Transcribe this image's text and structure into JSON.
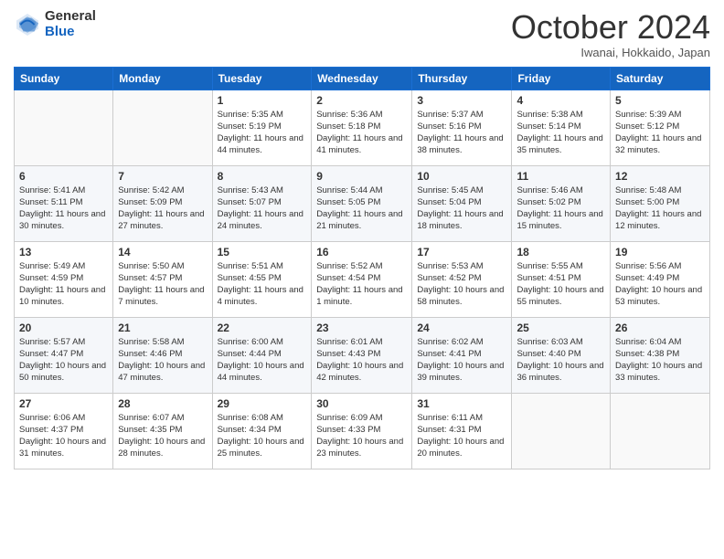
{
  "header": {
    "logo": {
      "general": "General",
      "blue": "Blue"
    },
    "title": "October 2024",
    "location": "Iwanai, Hokkaido, Japan"
  },
  "weekdays": [
    "Sunday",
    "Monday",
    "Tuesday",
    "Wednesday",
    "Thursday",
    "Friday",
    "Saturday"
  ],
  "weeks": [
    [
      {
        "day": "",
        "sunrise": "",
        "sunset": "",
        "daylight": ""
      },
      {
        "day": "",
        "sunrise": "",
        "sunset": "",
        "daylight": ""
      },
      {
        "day": "1",
        "sunrise": "Sunrise: 5:35 AM",
        "sunset": "Sunset: 5:19 PM",
        "daylight": "Daylight: 11 hours and 44 minutes."
      },
      {
        "day": "2",
        "sunrise": "Sunrise: 5:36 AM",
        "sunset": "Sunset: 5:18 PM",
        "daylight": "Daylight: 11 hours and 41 minutes."
      },
      {
        "day": "3",
        "sunrise": "Sunrise: 5:37 AM",
        "sunset": "Sunset: 5:16 PM",
        "daylight": "Daylight: 11 hours and 38 minutes."
      },
      {
        "day": "4",
        "sunrise": "Sunrise: 5:38 AM",
        "sunset": "Sunset: 5:14 PM",
        "daylight": "Daylight: 11 hours and 35 minutes."
      },
      {
        "day": "5",
        "sunrise": "Sunrise: 5:39 AM",
        "sunset": "Sunset: 5:12 PM",
        "daylight": "Daylight: 11 hours and 32 minutes."
      }
    ],
    [
      {
        "day": "6",
        "sunrise": "Sunrise: 5:41 AM",
        "sunset": "Sunset: 5:11 PM",
        "daylight": "Daylight: 11 hours and 30 minutes."
      },
      {
        "day": "7",
        "sunrise": "Sunrise: 5:42 AM",
        "sunset": "Sunset: 5:09 PM",
        "daylight": "Daylight: 11 hours and 27 minutes."
      },
      {
        "day": "8",
        "sunrise": "Sunrise: 5:43 AM",
        "sunset": "Sunset: 5:07 PM",
        "daylight": "Daylight: 11 hours and 24 minutes."
      },
      {
        "day": "9",
        "sunrise": "Sunrise: 5:44 AM",
        "sunset": "Sunset: 5:05 PM",
        "daylight": "Daylight: 11 hours and 21 minutes."
      },
      {
        "day": "10",
        "sunrise": "Sunrise: 5:45 AM",
        "sunset": "Sunset: 5:04 PM",
        "daylight": "Daylight: 11 hours and 18 minutes."
      },
      {
        "day": "11",
        "sunrise": "Sunrise: 5:46 AM",
        "sunset": "Sunset: 5:02 PM",
        "daylight": "Daylight: 11 hours and 15 minutes."
      },
      {
        "day": "12",
        "sunrise": "Sunrise: 5:48 AM",
        "sunset": "Sunset: 5:00 PM",
        "daylight": "Daylight: 11 hours and 12 minutes."
      }
    ],
    [
      {
        "day": "13",
        "sunrise": "Sunrise: 5:49 AM",
        "sunset": "Sunset: 4:59 PM",
        "daylight": "Daylight: 11 hours and 10 minutes."
      },
      {
        "day": "14",
        "sunrise": "Sunrise: 5:50 AM",
        "sunset": "Sunset: 4:57 PM",
        "daylight": "Daylight: 11 hours and 7 minutes."
      },
      {
        "day": "15",
        "sunrise": "Sunrise: 5:51 AM",
        "sunset": "Sunset: 4:55 PM",
        "daylight": "Daylight: 11 hours and 4 minutes."
      },
      {
        "day": "16",
        "sunrise": "Sunrise: 5:52 AM",
        "sunset": "Sunset: 4:54 PM",
        "daylight": "Daylight: 11 hours and 1 minute."
      },
      {
        "day": "17",
        "sunrise": "Sunrise: 5:53 AM",
        "sunset": "Sunset: 4:52 PM",
        "daylight": "Daylight: 10 hours and 58 minutes."
      },
      {
        "day": "18",
        "sunrise": "Sunrise: 5:55 AM",
        "sunset": "Sunset: 4:51 PM",
        "daylight": "Daylight: 10 hours and 55 minutes."
      },
      {
        "day": "19",
        "sunrise": "Sunrise: 5:56 AM",
        "sunset": "Sunset: 4:49 PM",
        "daylight": "Daylight: 10 hours and 53 minutes."
      }
    ],
    [
      {
        "day": "20",
        "sunrise": "Sunrise: 5:57 AM",
        "sunset": "Sunset: 4:47 PM",
        "daylight": "Daylight: 10 hours and 50 minutes."
      },
      {
        "day": "21",
        "sunrise": "Sunrise: 5:58 AM",
        "sunset": "Sunset: 4:46 PM",
        "daylight": "Daylight: 10 hours and 47 minutes."
      },
      {
        "day": "22",
        "sunrise": "Sunrise: 6:00 AM",
        "sunset": "Sunset: 4:44 PM",
        "daylight": "Daylight: 10 hours and 44 minutes."
      },
      {
        "day": "23",
        "sunrise": "Sunrise: 6:01 AM",
        "sunset": "Sunset: 4:43 PM",
        "daylight": "Daylight: 10 hours and 42 minutes."
      },
      {
        "day": "24",
        "sunrise": "Sunrise: 6:02 AM",
        "sunset": "Sunset: 4:41 PM",
        "daylight": "Daylight: 10 hours and 39 minutes."
      },
      {
        "day": "25",
        "sunrise": "Sunrise: 6:03 AM",
        "sunset": "Sunset: 4:40 PM",
        "daylight": "Daylight: 10 hours and 36 minutes."
      },
      {
        "day": "26",
        "sunrise": "Sunrise: 6:04 AM",
        "sunset": "Sunset: 4:38 PM",
        "daylight": "Daylight: 10 hours and 33 minutes."
      }
    ],
    [
      {
        "day": "27",
        "sunrise": "Sunrise: 6:06 AM",
        "sunset": "Sunset: 4:37 PM",
        "daylight": "Daylight: 10 hours and 31 minutes."
      },
      {
        "day": "28",
        "sunrise": "Sunrise: 6:07 AM",
        "sunset": "Sunset: 4:35 PM",
        "daylight": "Daylight: 10 hours and 28 minutes."
      },
      {
        "day": "29",
        "sunrise": "Sunrise: 6:08 AM",
        "sunset": "Sunset: 4:34 PM",
        "daylight": "Daylight: 10 hours and 25 minutes."
      },
      {
        "day": "30",
        "sunrise": "Sunrise: 6:09 AM",
        "sunset": "Sunset: 4:33 PM",
        "daylight": "Daylight: 10 hours and 23 minutes."
      },
      {
        "day": "31",
        "sunrise": "Sunrise: 6:11 AM",
        "sunset": "Sunset: 4:31 PM",
        "daylight": "Daylight: 10 hours and 20 minutes."
      },
      {
        "day": "",
        "sunrise": "",
        "sunset": "",
        "daylight": ""
      },
      {
        "day": "",
        "sunrise": "",
        "sunset": "",
        "daylight": ""
      }
    ]
  ]
}
